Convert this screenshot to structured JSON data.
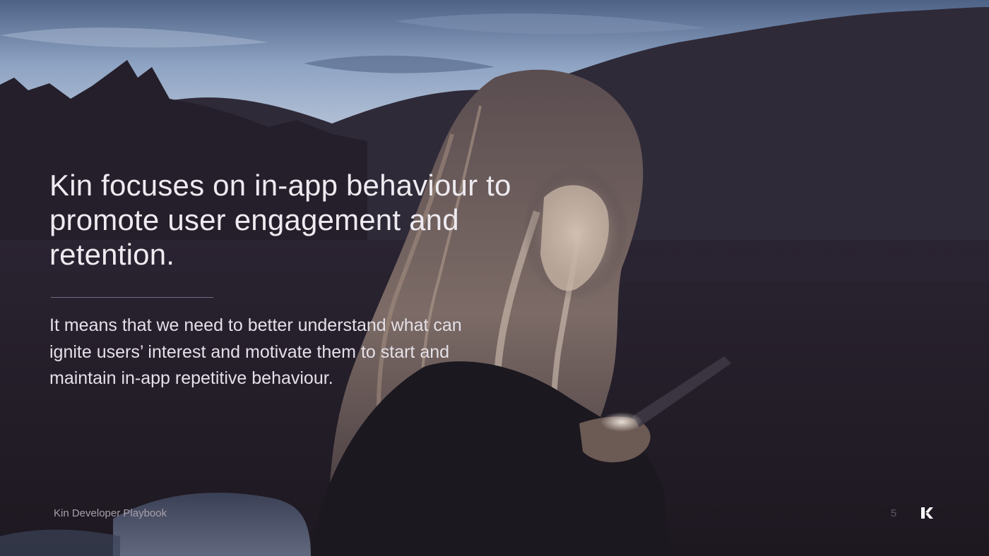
{
  "slide": {
    "headline": "Kin focuses on in-app behaviour to promote user engagement and retention.",
    "body": "It means that we need to better understand what can ignite users’ interest and motivate them to start and maintain in-app repetitive behaviour.",
    "footer_title": "Kin Developer Playbook",
    "page_number": "5",
    "logo_icon": "kin-logo-icon",
    "photo_subject": "woman-with-phone-at-dusk"
  },
  "colors": {
    "sky": "#8fa4c4",
    "mountains": "#2f2a38",
    "background": "#231d26",
    "text": "#eeeaf0",
    "divider": "#6f6d86",
    "footer_text": "#a8a0ac"
  }
}
